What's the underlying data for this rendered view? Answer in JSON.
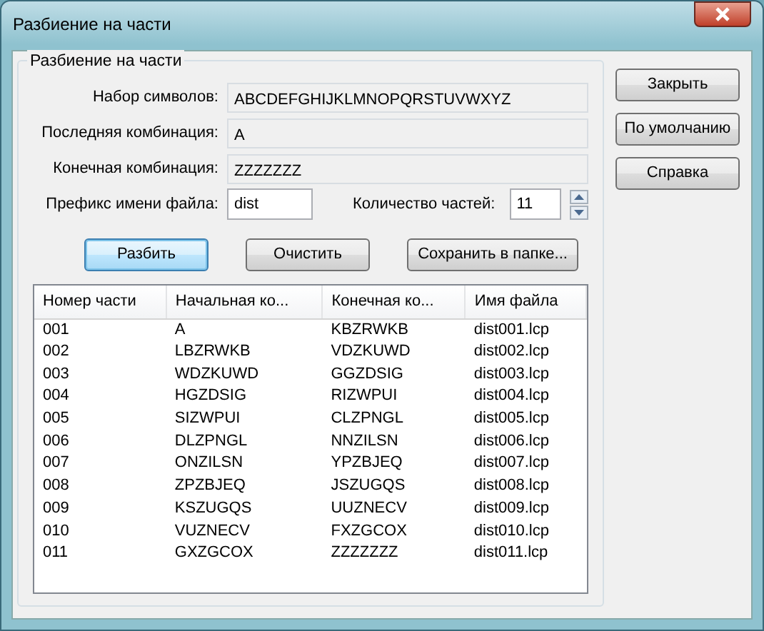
{
  "window": {
    "title": "Разбиение на части"
  },
  "group": {
    "title": "Разбиение на части"
  },
  "fields": [
    {
      "label": "Набор символов:",
      "value": "ABCDEFGHIJKLMNOPQRSTUVWXYZ"
    },
    {
      "label": "Последняя комбинация:",
      "value": "A"
    },
    {
      "label": "Конечная комбинация:",
      "value": "ZZZZZZZ"
    }
  ],
  "prefix": {
    "label": "Префикс имени файла:",
    "value": "dist"
  },
  "count": {
    "label": "Количество частей:",
    "value": "11"
  },
  "actions": [
    {
      "label": "Разбить",
      "selected": true
    },
    {
      "label": "Очистить",
      "selected": false
    },
    {
      "label": "Сохранить в папке...",
      "selected": false
    }
  ],
  "table": {
    "columns": [
      "Номер части",
      "Начальная ко...",
      "Конечная ко...",
      "Имя файла"
    ],
    "rows": [
      [
        "001",
        "A",
        "KBZRWKB",
        "dist001.lcp"
      ],
      [
        "002",
        "LBZRWKB",
        "VDZKUWD",
        "dist002.lcp"
      ],
      [
        "003",
        "WDZKUWD",
        "GGZDSIG",
        "dist003.lcp"
      ],
      [
        "004",
        "HGZDSIG",
        "RIZWPUI",
        "dist004.lcp"
      ],
      [
        "005",
        "SIZWPUI",
        "CLZPNGL",
        "dist005.lcp"
      ],
      [
        "006",
        "DLZPNGL",
        "NNZILSN",
        "dist006.lcp"
      ],
      [
        "007",
        "ONZILSN",
        "YPZBJEQ",
        "dist007.lcp"
      ],
      [
        "008",
        "ZPZBJEQ",
        "JSZUGQS",
        "dist008.lcp"
      ],
      [
        "009",
        "KSZUGQS",
        "UUZNECV",
        "dist009.lcp"
      ],
      [
        "010",
        "VUZNECV",
        "FXZGCOX",
        "dist010.lcp"
      ],
      [
        "011",
        "GXZGCOX",
        "ZZZZZZZ",
        "dist011.lcp"
      ]
    ]
  },
  "side_buttons": [
    "Закрыть",
    "По умолчанию",
    "Справка"
  ]
}
